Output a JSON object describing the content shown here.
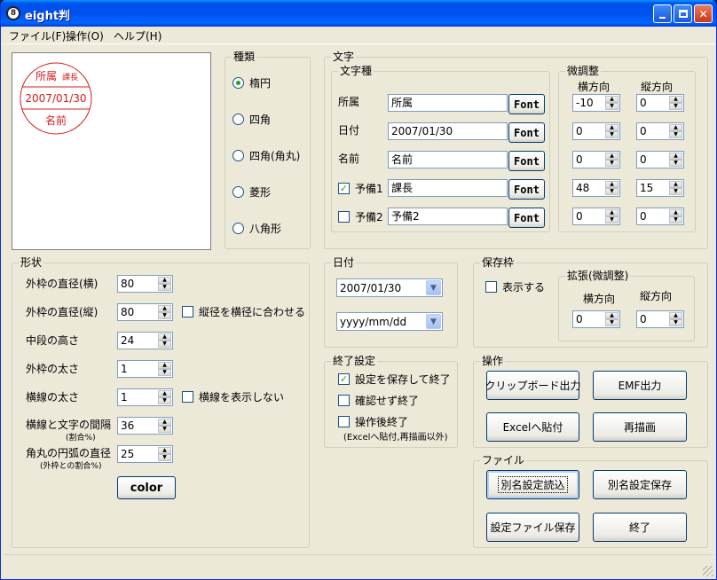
{
  "window": {
    "title": "eight判",
    "app_icon": "8"
  },
  "menu": [
    "ファイル(F)",
    "操作(O)",
    "ヘルプ(H)"
  ],
  "preview": {
    "top": "所属",
    "top_small": "課長",
    "middle": "2007/01/30",
    "bottom": "名前",
    "color": "#D61C1C"
  },
  "shape_type": {
    "label": "種類",
    "options": [
      "楕円",
      "四角",
      "四角(角丸)",
      "菱形",
      "八角形"
    ],
    "selected": 0
  },
  "text": {
    "label": "文字",
    "kind_label": "文字種",
    "adjust_label": "微調整",
    "h_label": "横方向",
    "v_label": "縦方向",
    "rows": [
      {
        "label": "所属",
        "value": "所属",
        "font": "Font",
        "h": "-10",
        "v": "0",
        "has_check": false
      },
      {
        "label": "日付",
        "value": "2007/01/30",
        "font": "Font",
        "h": "0",
        "v": "0",
        "has_check": false
      },
      {
        "label": "名前",
        "value": "名前",
        "font": "Font",
        "h": "0",
        "v": "0",
        "has_check": false
      },
      {
        "label": "予備1",
        "value": "課長",
        "font": "Font",
        "h": "48",
        "v": "15",
        "has_check": true,
        "checked": true
      },
      {
        "label": "予備2",
        "value": "予備2",
        "font": "Font",
        "h": "0",
        "v": "0",
        "has_check": true,
        "checked": false
      }
    ]
  },
  "shape": {
    "label": "形状",
    "rows": [
      {
        "label": "外枠の直径(横)",
        "value": "80"
      },
      {
        "label": "外枠の直径(縦)",
        "value": "80"
      },
      {
        "label": "中段の高さ",
        "value": "24"
      },
      {
        "label": "外枠の太さ",
        "value": "1"
      },
      {
        "label": "横線の太さ",
        "value": "1"
      },
      {
        "label": "横線と文字の間隔",
        "sub": "(割合%)",
        "value": "36"
      },
      {
        "label": "角丸の円弧の直径",
        "sub": "(外枠との割合%)",
        "value": "25"
      }
    ],
    "check_vertical": "縦径を横径に合わせる",
    "check_hide_line": "横線を表示しない",
    "color_button": "color"
  },
  "date": {
    "label": "日付",
    "value": "2007/01/30",
    "format": "yyyy/mm/dd"
  },
  "save_frame": {
    "label": "保存枠",
    "show": "表示する",
    "ext_label": "拡張(微調整)",
    "h_label": "横方向",
    "v_label": "縦方向",
    "h": "0",
    "v": "0"
  },
  "end_settings": {
    "label": "終了設定",
    "options": [
      {
        "label": "設定を保存して終了",
        "checked": true
      },
      {
        "label": "確認せず終了",
        "checked": false
      },
      {
        "label": "操作後終了",
        "checked": false
      }
    ],
    "note": "(Excelへ貼付,再描画以外)"
  },
  "operations": {
    "label": "操作",
    "clipboard": "クリップボード出力",
    "emf": "EMF出力",
    "excel": "Excelへ貼付",
    "redraw": "再描画"
  },
  "file": {
    "label": "ファイル",
    "load_as": "別名設定読込",
    "save_as": "別名設定保存",
    "save_file": "設定ファイル保存",
    "exit": "終了"
  }
}
